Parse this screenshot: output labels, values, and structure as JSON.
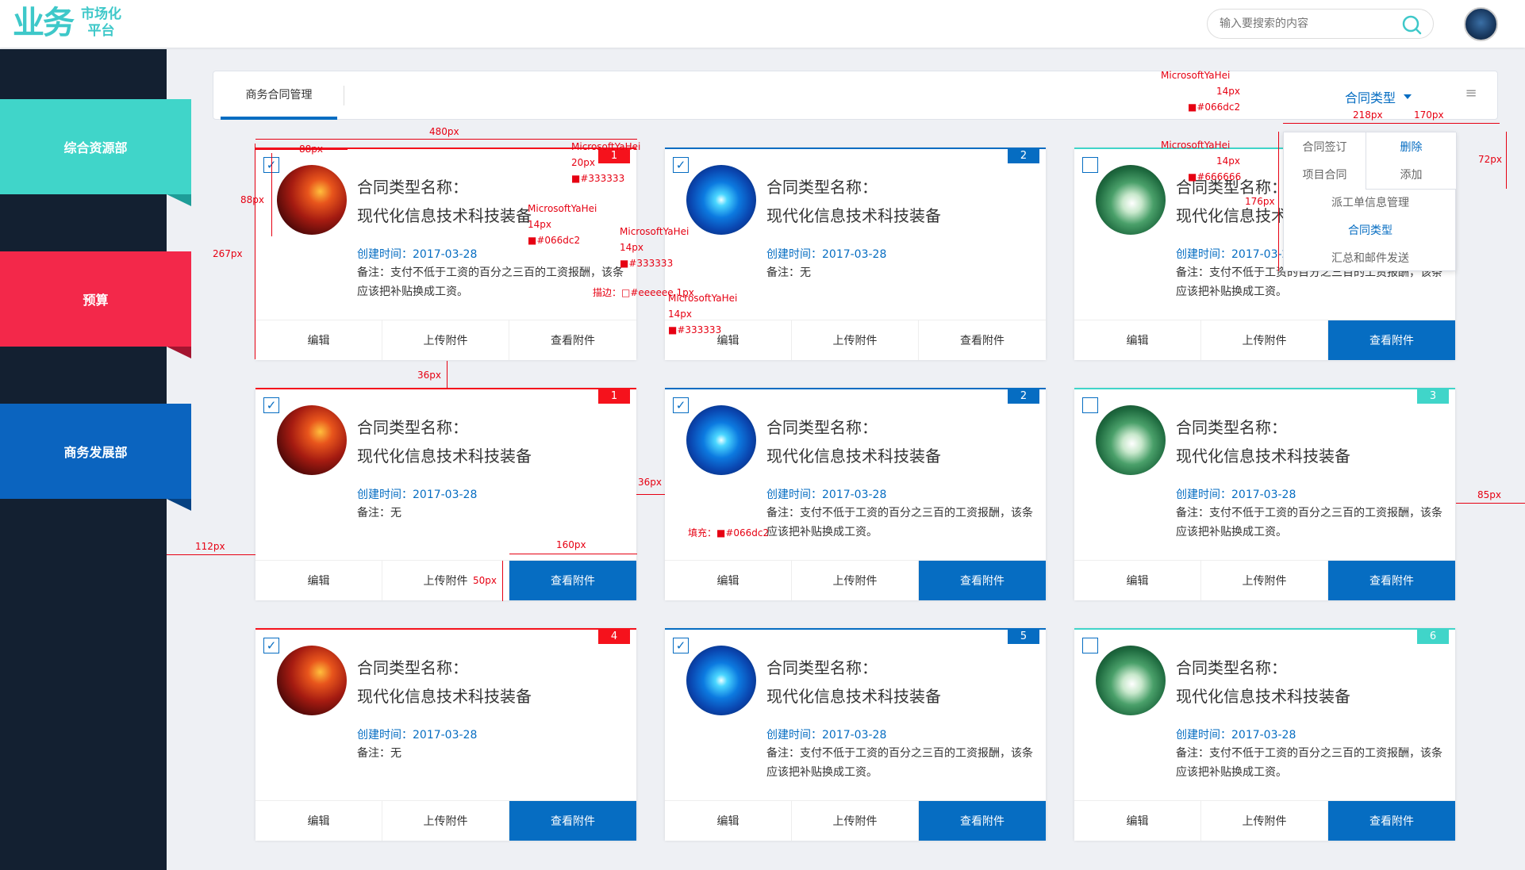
{
  "logo": {
    "mark": "业务",
    "line1": "市场化",
    "line2": "平台"
  },
  "search": {
    "placeholder": "输入要搜索的内容"
  },
  "sidebar": {
    "items": [
      {
        "label": "综合资源部",
        "color": "#40d5c9",
        "fold": "#1e9d98"
      },
      {
        "label": "预算",
        "color": "#f3284a",
        "fold": "#a31530"
      },
      {
        "label": "商务发展部",
        "color": "#0b64bf",
        "fold": "#064282"
      }
    ]
  },
  "tabs": {
    "active": "商务合同管理"
  },
  "toolbar": {
    "type_label": "合同类型",
    "menu_icon": "list-icon"
  },
  "dropdown": {
    "items": [
      "合同签订",
      "项目合同",
      "派工单信息管理",
      "合同类型",
      "汇总和邮件发送"
    ],
    "submenu": [
      "删除",
      "添加"
    ]
  },
  "card": {
    "title_line1": "合同类型名称：",
    "title_line2": "现代化信息技术科技装备",
    "created": "创建时间：2017-03-28",
    "note_long": "备注：支付不低于工资的百分之三百的工资报酬，该条应该把补贴换成工资。",
    "note_none": "备注：无",
    "btn_edit": "编辑",
    "btn_upload": "上传附件",
    "btn_view": "查看附件"
  },
  "cards": [
    {
      "num": "1",
      "badge": "#f5121c",
      "checked": true,
      "thumb": "red",
      "note": "long",
      "primary": false
    },
    {
      "num": "2",
      "badge": "#066dc2",
      "checked": true,
      "thumb": "blue",
      "note": "none",
      "primary": false
    },
    {
      "num": "3",
      "badge": "#40d5c9",
      "checked": false,
      "thumb": "green",
      "note": "long",
      "primary": true
    },
    {
      "num": "1",
      "badge": "#f5121c",
      "checked": true,
      "thumb": "red",
      "note": "none",
      "primary": true
    },
    {
      "num": "2",
      "badge": "#066dc2",
      "checked": true,
      "thumb": "blue",
      "note": "long",
      "primary": true
    },
    {
      "num": "3",
      "badge": "#40d5c9",
      "checked": false,
      "thumb": "green",
      "note": "long",
      "primary": true
    },
    {
      "num": "4",
      "badge": "#f5121c",
      "checked": true,
      "thumb": "red",
      "note": "none",
      "primary": true
    },
    {
      "num": "5",
      "badge": "#066dc2",
      "checked": true,
      "thumb": "blue",
      "note": "long",
      "primary": true
    },
    {
      "num": "6",
      "badge": "#40d5c9",
      "checked": false,
      "thumb": "green",
      "note": "long",
      "primary": true
    }
  ],
  "annotations": {
    "w480": "480px",
    "w88": "88px",
    "h88": "88px",
    "h267": "267px",
    "g36": "36px",
    "g36b": "36px",
    "m112": "112px",
    "w160": "160px",
    "h50": "50px",
    "m85": "85px",
    "w218": "218px",
    "w170": "170px",
    "h72": "72px",
    "h176": "176px",
    "f_title": "MicrosoftYaHei",
    "s_title": "20px",
    "c_title": "■#333333",
    "f_time": "MicrosoftYaHei",
    "s_time": "14px",
    "c_time": "■#066dc2",
    "f_note": "MicrosoftYaHei",
    "s_note": "14px",
    "c_note": "■#333333",
    "stroke": "描边：□#eeeeee 1px",
    "f_btn": "MicrosoftYaHei",
    "s_btn": "14px",
    "c_btn": "■#333333",
    "fill": "填充：■#066dc2",
    "f_dd": "MicrosoftYaHei",
    "s_dd": "14px",
    "c_dd": "■#066dc2",
    "f_menu": "MicrosoftYaHei",
    "s_menu": "14px",
    "c_menu": "■#666666"
  }
}
